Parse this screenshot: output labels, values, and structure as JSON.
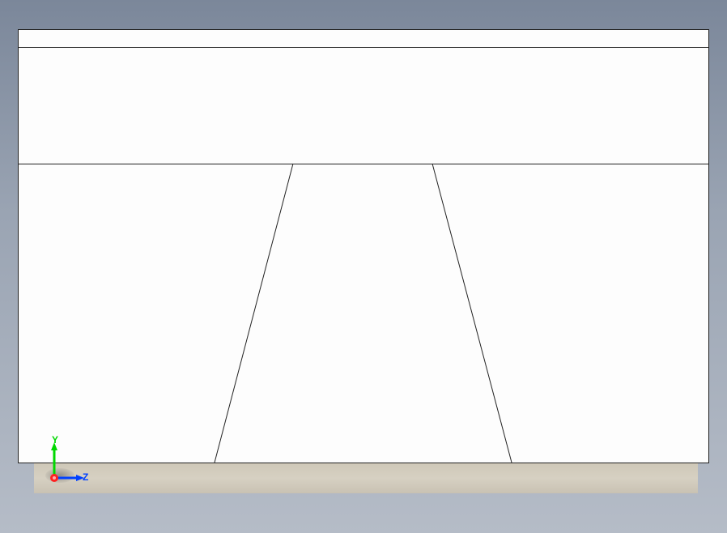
{
  "triad": {
    "y_label": "Y",
    "z_label": "Z",
    "y_color": "#00d800",
    "z_color": "#0040ff",
    "x_color": "#ff2020"
  },
  "model": {
    "face_color": "#fdfdfd",
    "edge_color": "#222222",
    "base_color": "#d0cabb"
  }
}
